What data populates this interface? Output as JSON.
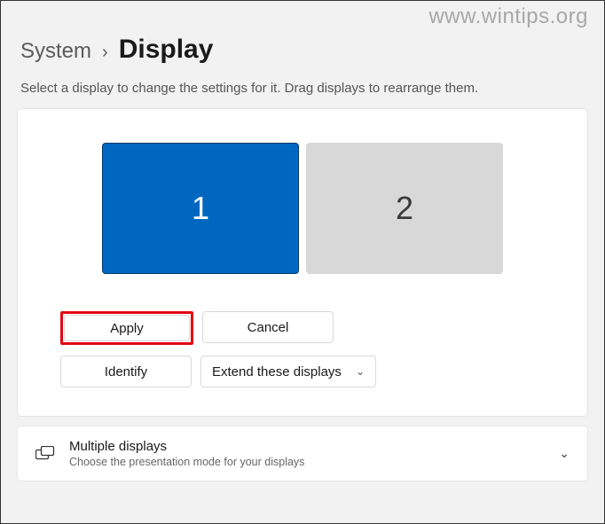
{
  "watermark": "www.wintips.org",
  "breadcrumb": {
    "parent": "System",
    "separator": "›",
    "current": "Display"
  },
  "helper_text": "Select a display to change the settings for it. Drag displays to rearrange them.",
  "displays": [
    {
      "label": "1",
      "selected": true
    },
    {
      "label": "2",
      "selected": false
    }
  ],
  "buttons": {
    "apply": "Apply",
    "cancel": "Cancel",
    "identify": "Identify",
    "mode_selected": "Extend these displays"
  },
  "multi_section": {
    "title": "Multiple displays",
    "subtitle": "Choose the presentation mode for your displays"
  }
}
